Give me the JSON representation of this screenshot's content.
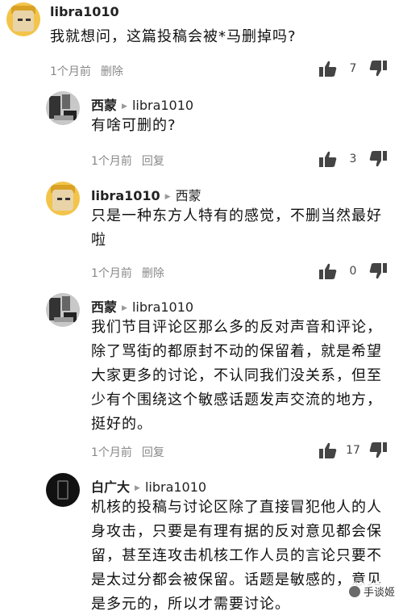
{
  "comments": [
    {
      "author": "libra1010",
      "reply_to": "",
      "text": "我就想问，这篇投稿会被*马删掉吗?",
      "time": "1个月前",
      "action": "删除",
      "likes": "7"
    },
    {
      "author": "西蒙",
      "reply_to": "libra1010",
      "text": "有啥可删的?",
      "time": "1个月前",
      "action": "回复",
      "likes": "3"
    },
    {
      "author": "libra1010",
      "reply_to": "西蒙",
      "text": "只是一种东方人特有的感觉，不删当然最好啦",
      "time": "1个月前",
      "action": "删除",
      "likes": "0"
    },
    {
      "author": "西蒙",
      "reply_to": "libra1010",
      "text": "我们节目评论区那么多的反对声音和评论，除了骂街的都原封不动的保留着，就是希望大家更多的讨论，不认同我们没关系，但至少有个围绕这个敏感话题发声交流的地方，挺好的。",
      "time": "1个月前",
      "action": "回复",
      "likes": "17"
    },
    {
      "author": "白广大",
      "reply_to": "libra1010",
      "text": "机核的投稿与讨论区除了直接冒犯他人的人身攻击，只要是有理有据的反对意见都会保留，甚至连攻击机核工作人员的言论只要不是太过分都会被保留。话题是敏感的，意见是多元的，所以才需要讨论。"
    }
  ],
  "watermark": "手谈姬",
  "colors": {
    "text": "#111111",
    "meta": "#888888",
    "icon": "#444444"
  }
}
